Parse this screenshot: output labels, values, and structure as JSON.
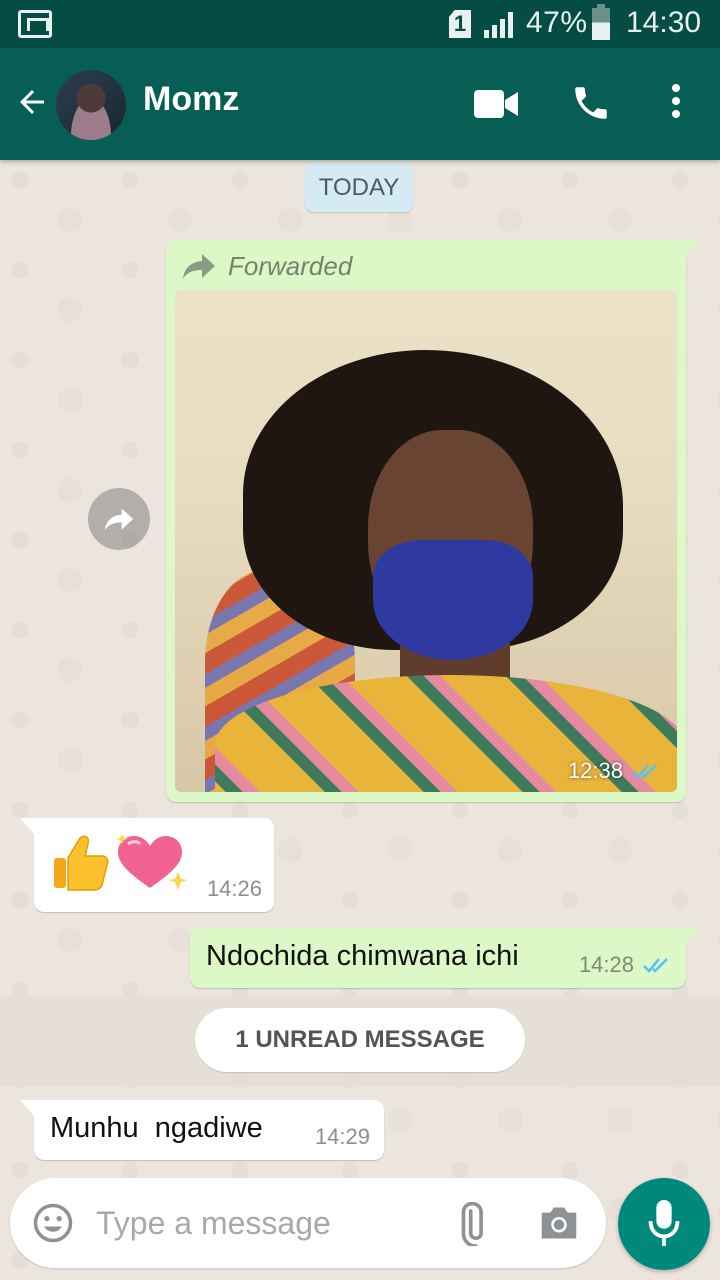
{
  "status_bar": {
    "sim_slot": "1",
    "battery_percent": "47%",
    "time": "14:30"
  },
  "header": {
    "contact_name": "Momz",
    "icons": [
      "back-arrow-icon",
      "video-call-icon",
      "phone-call-icon",
      "more-options-icon"
    ]
  },
  "chat": {
    "date_chip": "TODAY",
    "messages": [
      {
        "direction": "outgoing",
        "type": "image",
        "forwarded_label": "Forwarded",
        "time": "12:38",
        "status": "read"
      },
      {
        "direction": "incoming",
        "type": "emoji",
        "emojis": [
          "👍",
          "💖"
        ],
        "time": "14:26"
      },
      {
        "direction": "outgoing",
        "type": "text",
        "text": "Ndochida chimwana ichi",
        "time": "14:28",
        "status": "read"
      },
      {
        "direction": "incoming",
        "type": "text",
        "text": "Munhu  ngadiwe",
        "time": "14:29"
      }
    ],
    "unread_banner": "1 UNREAD MESSAGE"
  },
  "composer": {
    "placeholder": "Type a message",
    "icons": [
      "emoji-icon",
      "attach-icon",
      "camera-icon",
      "mic-icon"
    ]
  },
  "colors": {
    "status_bar": "#054d44",
    "app_bar": "#075e54",
    "outgoing_bubble": "#dcf8c6",
    "incoming_bubble": "#ffffff",
    "read_ticks": "#4fc3f7",
    "mic_button": "#00897b"
  }
}
